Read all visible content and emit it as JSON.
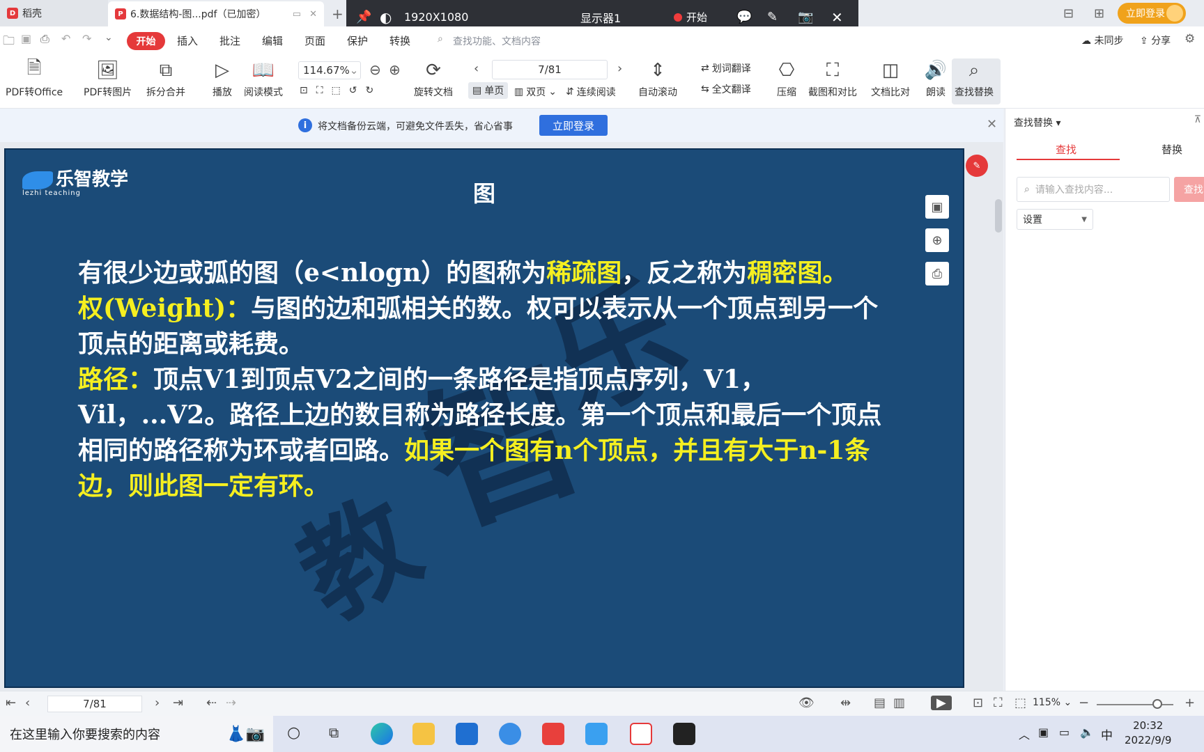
{
  "tabs": {
    "home": "稻壳",
    "doc": "6.数据结构-图...pdf（已加密）"
  },
  "recorder": {
    "resolution": "1920X1080",
    "monitor": "显示器1",
    "start": "开始"
  },
  "account": {
    "login": "立即登录",
    "sync": "未同步",
    "share": "分享"
  },
  "menu": {
    "start": "开始",
    "items": [
      "插入",
      "批注",
      "编辑",
      "页面",
      "保护",
      "转换"
    ],
    "search_placeholder": "查找功能、文档内容"
  },
  "ribbon": {
    "pdf_to_office": "PDF转Office",
    "pdf_to_image": "PDF转图片",
    "split_merge": "拆分合并",
    "play": "播放",
    "read_mode": "阅读模式",
    "zoom": "114.67%",
    "rotate": "旋转文档",
    "page": "7/81",
    "single": "单页",
    "double": "双页",
    "continuous": "连续阅读",
    "autoscroll": "自动滚动",
    "word_translate": "划词翻译",
    "full_translate": "全文翻译",
    "compress": "压缩",
    "screenshot_compare": "截图和对比",
    "doc_compare": "文档比对",
    "read_aloud": "朗读",
    "find_replace": "查找替换"
  },
  "notify": {
    "text": "将文档备份云端，可避免文件丢失，省心省事",
    "button": "立即登录"
  },
  "slide": {
    "brand": "乐智教学",
    "brand_sub": "lezhi teaching",
    "title": "图",
    "watermark_a": "乐",
    "watermark_b": "智",
    "watermark_c": "教",
    "p1_a": "有很少边或弧的图（e<nlogn）的图称为",
    "p1_b": "稀疏图",
    "p1_c": "，反之称为",
    "p1_d": "稠密图。",
    "p2_a": "权(Weight)：",
    "p2_b": "与图的边和弧相关的数。权可以表示从一个顶点到另一个顶点的距离或耗费。",
    "p3_a": "路径：",
    "p3_b": "顶点V1到顶点V2之间的一条路径是指顶点序列，V1，Vil，...V2。路径上边的数目称为路径长度。第一个顶点和最后一个顶点相同的路径称为环或者回路。",
    "p3_c": "如果一个图有n个顶点，并且有大于n-1条边，则此图一定有环。"
  },
  "rpanel": {
    "title": "查找替换",
    "tab_find": "查找",
    "tab_replace": "替换",
    "search_placeholder": "请输入查找内容...",
    "find_btn": "查找",
    "settings": "设置"
  },
  "status": {
    "page": "7/81",
    "zoom": "115%"
  },
  "taskbar": {
    "search": "在这里输入你要搜索的内容",
    "ime": "中",
    "time": "20:32",
    "date": "2022/9/9"
  }
}
